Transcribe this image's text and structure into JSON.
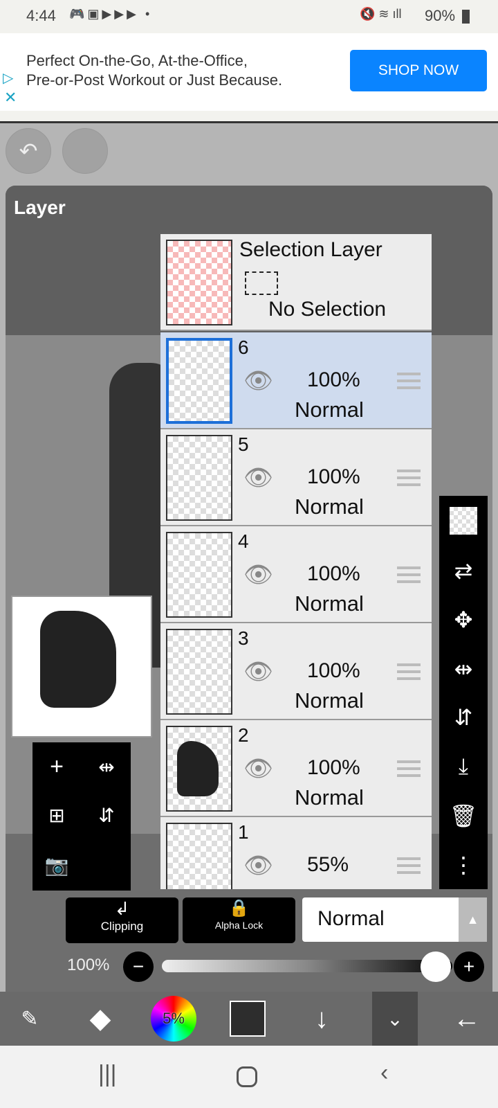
{
  "status": {
    "time": "4:44",
    "battery": "90%"
  },
  "ad": {
    "line1": "Perfect On-the-Go, At-the-Office,",
    "line2": "Pre-or-Post Workout or Just Because.",
    "cta": "SHOP NOW",
    "cta_color": "#0a84ff"
  },
  "panel": {
    "title": "Layer"
  },
  "selection_layer": {
    "title": "Selection Layer",
    "status": "No Selection"
  },
  "layers": [
    {
      "num": "6",
      "opacity": "100%",
      "mode": "Normal",
      "selected": true
    },
    {
      "num": "5",
      "opacity": "100%",
      "mode": "Normal"
    },
    {
      "num": "4",
      "opacity": "100%",
      "mode": "Normal"
    },
    {
      "num": "3",
      "opacity": "100%",
      "mode": "Normal"
    },
    {
      "num": "2",
      "opacity": "100%",
      "mode": "Normal"
    },
    {
      "num": "1",
      "opacity": "55%",
      "mode": ""
    }
  ],
  "controls": {
    "clipping": "Clipping",
    "alpha_lock": "Alpha Lock",
    "blend_mode": "Normal",
    "opacity": "100%",
    "opacity_value": 100
  },
  "toolbar": {
    "color_percent": "5%"
  }
}
